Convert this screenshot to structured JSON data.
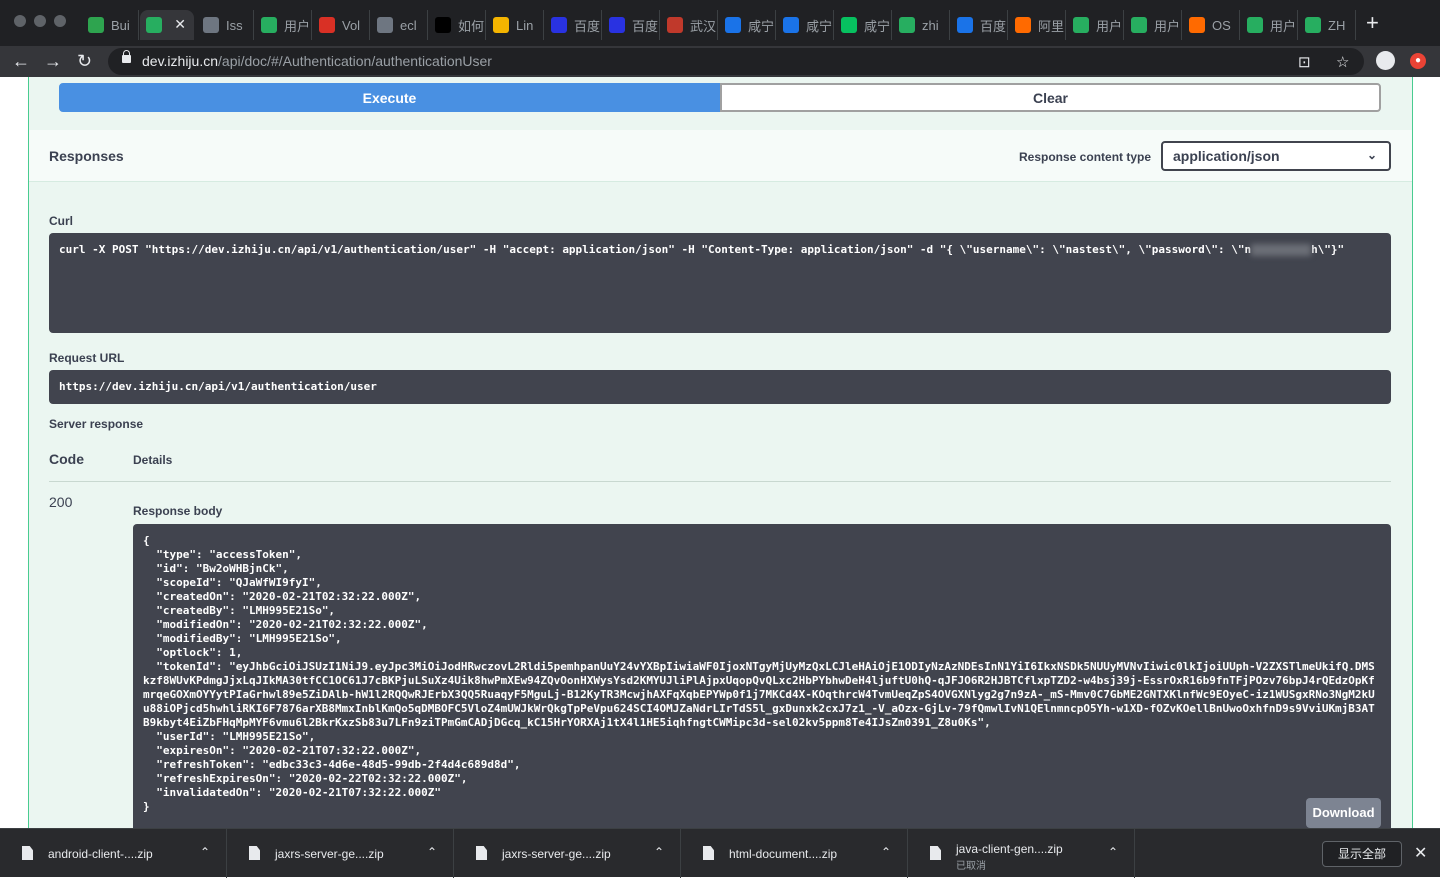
{
  "browser": {
    "tabs": [
      {
        "label": "Bui",
        "icon": "build-icon",
        "color": "#2ea44f"
      },
      {
        "label": "",
        "icon": "izhiju-icon",
        "color": "#27ae60",
        "active": true
      },
      {
        "label": "Iss",
        "icon": "github-icon",
        "color": "#6e7681"
      },
      {
        "label": "用户",
        "icon": "izhiju-icon",
        "color": "#27ae60"
      },
      {
        "label": "Vol",
        "icon": "volume-icon",
        "color": "#d93025"
      },
      {
        "label": "ecl",
        "icon": "github-icon",
        "color": "#6e7681"
      },
      {
        "label": "如何",
        "icon": "symfony-icon",
        "color": "#000000"
      },
      {
        "label": "Lin",
        "icon": "linux-icon",
        "color": "#f4b400"
      },
      {
        "label": "百度",
        "icon": "baidu-icon",
        "color": "#2932e1"
      },
      {
        "label": "百度",
        "icon": "baidu-icon",
        "color": "#2932e1"
      },
      {
        "label": "武汉",
        "icon": "wuhan-icon",
        "color": "#c0392b"
      },
      {
        "label": "咸宁",
        "icon": "xianning-icon",
        "color": "#1a73e8"
      },
      {
        "label": "咸宁",
        "icon": "xianning-icon",
        "color": "#1a73e8"
      },
      {
        "label": "咸宁",
        "icon": "wechat-icon",
        "color": "#07c160"
      },
      {
        "label": "zhi",
        "icon": "zhi-icon",
        "color": "#27ae60"
      },
      {
        "label": "百度",
        "icon": "baidu-cloud-icon",
        "color": "#1a73e8"
      },
      {
        "label": "阿里",
        "icon": "aliyun-icon",
        "color": "#ff6a00"
      },
      {
        "label": "用户",
        "icon": "izhiju-icon",
        "color": "#27ae60"
      },
      {
        "label": "用户",
        "icon": "izhiju-icon",
        "color": "#27ae60"
      },
      {
        "label": "OS",
        "icon": "aliyun-icon",
        "color": "#ff6a00"
      },
      {
        "label": "用户",
        "icon": "izhiju-icon",
        "color": "#27ae60"
      },
      {
        "label": "ZH",
        "icon": "izhiju-icon",
        "color": "#27ae60"
      }
    ],
    "url_host": "dev.izhiju.cn",
    "url_path": "/api/doc/#/Authentication/authenticationUser"
  },
  "actions": {
    "execute_label": "Execute",
    "clear_label": "Clear"
  },
  "responses": {
    "title": "Responses",
    "content_type_label": "Response content type",
    "content_type_value": "application/json"
  },
  "curl": {
    "label": "Curl",
    "command_prefix": "curl -X POST \"https://dev.izhiju.cn/api/v1/authentication/user\" -H \"accept: application/json\" -H \"Content-Type: application/json\" -d \"{ \\\"username\\\": \\\"nastest\\\", \\\"password\\\": \\\"n",
    "command_suffix": "h\\\"}\""
  },
  "request_url": {
    "label": "Request URL",
    "value": "https://dev.izhiju.cn/api/v1/authentication/user"
  },
  "server_response": {
    "label": "Server response",
    "code_header": "Code",
    "details_header": "Details",
    "code": "200",
    "body_label": "Response body",
    "body": "{\n  \"type\": \"accessToken\",\n  \"id\": \"Bw2oWHBjnCk\",\n  \"scopeId\": \"QJaWfWI9fyI\",\n  \"createdOn\": \"2020-02-21T02:32:22.000Z\",\n  \"createdBy\": \"LMH995E21So\",\n  \"modifiedOn\": \"2020-02-21T02:32:22.000Z\",\n  \"modifiedBy\": \"LMH995E21So\",\n  \"optlock\": 1,\n  \"tokenId\": \"eyJhbGciOiJSUzI1NiJ9.eyJpc3MiOiJodHRwczovL2Rldi5pemhpanUuY24vYXBpIiwiaWF0IjoxNTgyMjUyMzQxLCJleHAiOjE1ODIyNzAzNDEsInN1YiI6IkxNSDk5NUUyMVNvIiwic0lkIjoiUUph-V2ZXSTlmeUkifQ.DMSkzf8WUvKPdmgJjxLqJIkMA30tfCC1OC61J7cBKPjuLSuXz4Uik8hwPmXEw94ZQvOonHXWysYsd2KMYUJliPlAjpxUqopQvQLxc2HbPYbhwDeH4ljuftU0hQ-qJFJO6R2HJBTCflxpTZD2-w4bsj39j-EssrOxR16b9fnTFjPOzv76bpJ4rQEdzOpKfmrqeGOXmOYYytPIaGrhwl89e5ZiDAlb-hW1l2RQQwRJErbX3QQ5RuaqyF5MguLj-B12KyTR3McwjhAXFqXqbEPYWp0f1j7MKCd4X-KOqthrcW4TvmUeqZpS4OVGXNlyg2g7n9zA-_mS-Mmv0C7GbME2GNTXKlnfWc9EOyeC-iz1WUSgxRNo3NgM2kUu88iOPjcd5hwhliRKI6F7876arXB8MmxInblKmQo5qDMBOFC5VloZ4mUWJkWrQkgTpPeVpu624SCI4OMJZaNdrLIrTdS5l_gxDunxk2cxJ7z1_-V_aOzx-GjLv-79fQmwlIvN1QElnmncpO5Yh-w1XD-fOZvKOellBnUwoOxhfnD9s9VviUKmjB3ATB9kbyt4EiZbFHqMpMYF6vmu6l2BkrKxzSb83u7LFn9ziTPmGmCADjDGcq_kC15HrYORXAj1tX4l1HE5iqhfngtCWMipc3d-sel02kv5ppm8Te4IJsZm0391_Z8u0Ks\",\n  \"userId\": \"LMH995E21So\",\n  \"expiresOn\": \"2020-02-21T07:32:22.000Z\",\n  \"refreshToken\": \"edbc33c3-4d6e-48d5-99db-2f4d4c689d8d\",\n  \"refreshExpiresOn\": \"2020-02-22T02:32:22.000Z\",\n  \"invalidatedOn\": \"2020-02-21T07:32:22.000Z\"\n}",
    "download_label": "Download"
  },
  "downloads": {
    "items": [
      {
        "name": "android-client-....zip",
        "status": ""
      },
      {
        "name": "jaxrs-server-ge....zip",
        "status": ""
      },
      {
        "name": "jaxrs-server-ge....zip",
        "status": ""
      },
      {
        "name": "html-document....zip",
        "status": ""
      },
      {
        "name": "java-client-gen....zip",
        "status": "已取消"
      }
    ],
    "show_all_label": "显示全部"
  }
}
